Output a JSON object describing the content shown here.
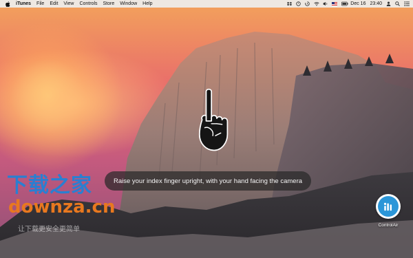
{
  "menubar": {
    "app_name": "iTunes",
    "menus": [
      "File",
      "Edit",
      "View",
      "Controls",
      "Store",
      "Window",
      "Help"
    ],
    "status_icons": [
      "dropbox-icon",
      "timer-icon",
      "time-machine-icon",
      "wifi-icon",
      "volume-icon",
      "flag-icon",
      "battery-icon"
    ],
    "date": "Dec 16",
    "time": "23:40"
  },
  "gesture": {
    "hand_icon": "index-finger-up-icon",
    "instruction": "Raise your index finger upright, with your hand facing the camera"
  },
  "watermark": {
    "title": "下载之家",
    "domain": "downza.cn",
    "subtitle": "让下载更安全更简单"
  },
  "desktop": {
    "app_label": "ControlAir",
    "icon_color": "#2b96d8"
  },
  "colors": {
    "menubar_bg": "#eeeeee",
    "caption_bg": "#282828",
    "watermark_blue": "#2a7fd1",
    "watermark_orange": "#e8781f"
  }
}
